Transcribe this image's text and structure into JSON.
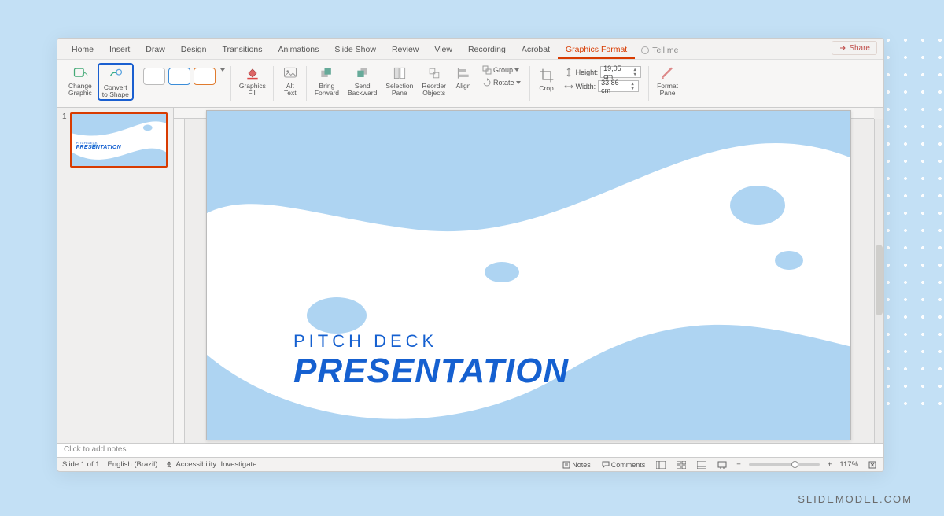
{
  "tabs": {
    "items": [
      "Home",
      "Insert",
      "Draw",
      "Design",
      "Transitions",
      "Animations",
      "Slide Show",
      "Review",
      "View",
      "Recording",
      "Acrobat",
      "Graphics Format"
    ],
    "active": "Graphics Format",
    "tell_me": "Tell me",
    "share": "Share"
  },
  "ribbon": {
    "change_graphic": "Change\nGraphic",
    "convert_to_shape": "Convert\nto Shape",
    "graphics_fill": "Graphics\nFill",
    "alt_text": "Alt\nText",
    "bring_forward": "Bring\nForward",
    "send_backward": "Send\nBackward",
    "selection_pane": "Selection\nPane",
    "reorder_objects": "Reorder\nObjects",
    "align": "Align",
    "group": "Group",
    "rotate": "Rotate",
    "crop": "Crop",
    "height_label": "Height:",
    "height_value": "19,05 cm",
    "width_label": "Width:",
    "width_value": "33,86 cm",
    "format_pane": "Format\nPane"
  },
  "slide": {
    "line1": "PITCH DECK",
    "line2": "PRESENTATION"
  },
  "thumbnail": {
    "number": "1"
  },
  "notes": {
    "placeholder": "Click to add notes"
  },
  "status": {
    "slide_info": "Slide 1 of 1",
    "language": "English (Brazil)",
    "accessibility": "Accessibility: Investigate",
    "notes_btn": "Notes",
    "comments_btn": "Comments",
    "zoom": "117%"
  },
  "brand": "SLIDEMODEL.COM",
  "colors": {
    "accent": "#1560d0",
    "shape": "#aed4f2",
    "active_tab": "#d83b01"
  }
}
